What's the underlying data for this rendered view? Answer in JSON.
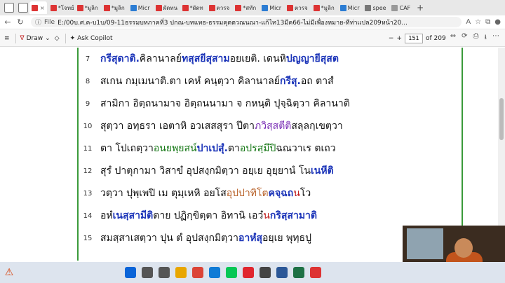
{
  "tabs": [
    {
      "label": "*โจทย์"
    },
    {
      "label": "*มูลิก"
    },
    {
      "label": "*มูลิก"
    },
    {
      "label": "Micr"
    },
    {
      "label": "ผัดทน"
    },
    {
      "label": "*ผัดท"
    },
    {
      "label": "ตวรจ"
    },
    {
      "label": "*สทัก"
    },
    {
      "label": "Micr"
    },
    {
      "label": "ตวรจ"
    },
    {
      "label": "*มูลิก"
    },
    {
      "label": "Micr"
    },
    {
      "label": "spee"
    },
    {
      "label": "CAF"
    }
  ],
  "address": {
    "scheme_label": "File",
    "url": "E:/00บ.ศ.ค-บ1บ/09-11ธรรมบทภาคที่3 ปกณ-บทแทธ-ธรรมคุตตวณนณา-แก้ไท13มีค66-ไม่มีเพื่องหมาย-ทีท่าแปล209หน้า20..."
  },
  "pdf_toolbar": {
    "draw_label": "Draw",
    "copilot_label": "Ask Copilot",
    "page_current": "151",
    "page_total": "of 209"
  },
  "lines": [
    {
      "num": "7",
      "segments": [
        {
          "t": "กรีสุดาติ.",
          "c": "blue"
        },
        {
          "t": " คิลานาลย์ "
        },
        {
          "t": "ทสุสยีสุสาม",
          "c": "blue"
        },
        {
          "t": " อยเยติ. เดนหิ "
        },
        {
          "t": "ปญญายีสุสต",
          "c": "blue"
        }
      ]
    },
    {
      "num": "8",
      "segments": [
        {
          "t": "สเกน กมฺเมนาติ.",
          "c": ""
        },
        {
          "t": " ตา เคหํ คนฺตฺวา คิลานาลย์ "
        },
        {
          "t": "กรีสุ.",
          "c": "blue"
        },
        {
          "t": " อถ ตาสํ"
        }
      ]
    },
    {
      "num": "9",
      "segments": [
        {
          "t": "สามิกา อิตฺถนามา",
          "c": ""
        },
        {
          "t": " จ อิตฺถนนามา จ กหนฺติ ปุจฺฉิตฺวา คิลานาติ"
        }
      ]
    },
    {
      "num": "10",
      "segments": [
        {
          "t": "สุตฺวา อทฺธรา เอตาหิ อวเสสสุรา ปีตา "
        },
        {
          "t": "ภวิสฺสตีติ",
          "c": "purple"
        },
        {
          "t": " สลฺลกฺเขตฺวา"
        }
      ]
    },
    {
      "num": "11",
      "segments": [
        {
          "t": "ตา โปเถตฺวา "
        },
        {
          "t": "อนยพฺยสน์",
          "c": "green"
        },
        {
          "t": " "
        },
        {
          "t": "ปาเปสุํ.",
          "c": "blue"
        },
        {
          "t": " ตา "
        },
        {
          "t": "อปรสฺมึปิ",
          "c": "green"
        },
        {
          "t": " ฉณวาเร ตเถว"
        }
      ]
    },
    {
      "num": "12",
      "segments": [
        {
          "t": "สุรํ ปาตุกามา วิสาขํ อุปสงฺกมิตฺวา อยฺเย อุยฺยานํ โน "
        },
        {
          "t": "เนหีติ",
          "c": "blue"
        }
      ]
    },
    {
      "num": "13",
      "segments": [
        {
          "t": "วตฺวา ปุพฺเพปิ เม ตุมฺเหหิ อยโส "
        },
        {
          "t": "อุปปาทิโต",
          "c": "orange"
        },
        {
          "t": " "
        },
        {
          "t": "คจฺฉถ",
          "c": "blue"
        },
        {
          "t": " "
        },
        {
          "t": "น",
          "c": "red"
        },
        {
          "t": " โว"
        }
      ]
    },
    {
      "num": "14",
      "segments": [
        {
          "t": "อหํ "
        },
        {
          "t": "เนสฺสามีติ",
          "c": "blue"
        },
        {
          "t": " ตาย ปฏิกฺขิตฺตา อิทานิ เอวํ "
        },
        {
          "t": "น",
          "c": "red"
        },
        {
          "t": " "
        },
        {
          "t": "กริสฺสามาติ",
          "c": "blue"
        }
      ]
    },
    {
      "num": "15",
      "segments": [
        {
          "t": "สมสฺสาเสตฺวา ปุน ตํ อุปสงฺกมิตฺวา "
        },
        {
          "t": "อาหํสุ",
          "c": "blue"
        },
        {
          "t": " อยฺเย พุทฺธปู"
        }
      ]
    }
  ],
  "colors": {
    "accent_blue": "#1a33b8",
    "accent_red": "#c02020",
    "rule_green": "#3a9a3a"
  },
  "taskbar_icons": [
    "windows-start-icon",
    "search-icon",
    "task-view-icon",
    "folder-icon",
    "chrome-icon",
    "edge-icon",
    "line-icon",
    "opera-icon",
    "media-icon",
    "word-icon",
    "excel-icon",
    "pdf-icon"
  ]
}
